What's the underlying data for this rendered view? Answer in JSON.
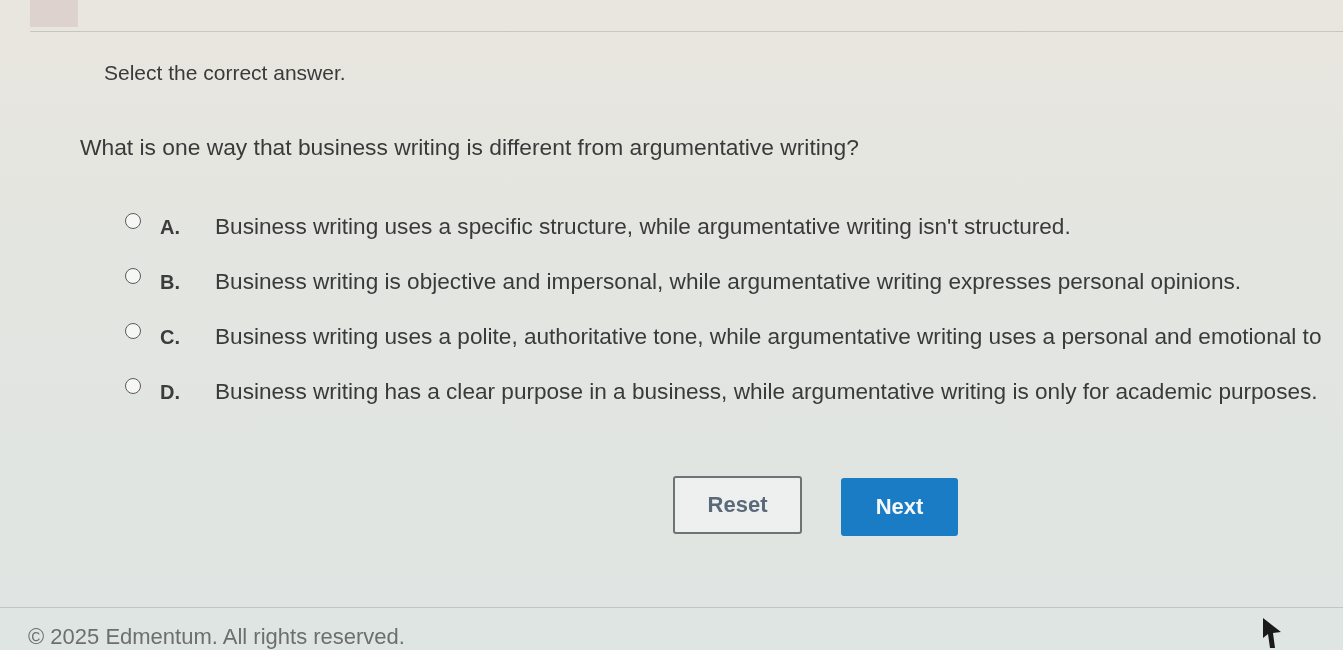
{
  "header": {
    "instruction": "Select the correct answer."
  },
  "question": {
    "prompt": "What is one way that business writing is different from argumentative writing?",
    "options": [
      {
        "letter": "A.",
        "text": "Business writing uses a specific structure, while argumentative writing isn't structured.",
        "selected": false
      },
      {
        "letter": "B.",
        "text": "Business writing is objective and impersonal, while argumentative writing expresses personal opinions.",
        "selected": false
      },
      {
        "letter": "C.",
        "text": "Business writing uses a polite, authoritative tone, while argumentative writing uses a personal and emotional to",
        "selected": false
      },
      {
        "letter": "D.",
        "text": "Business writing has a clear purpose in a business, while argumentative writing is only for academic purposes.",
        "selected": false
      }
    ]
  },
  "buttons": [
    {
      "label": "Reset",
      "kind": "secondary"
    },
    {
      "label": "Next",
      "kind": "primary"
    }
  ],
  "footer": {
    "copyright": "© 2025 Edmentum. All rights reserved."
  }
}
